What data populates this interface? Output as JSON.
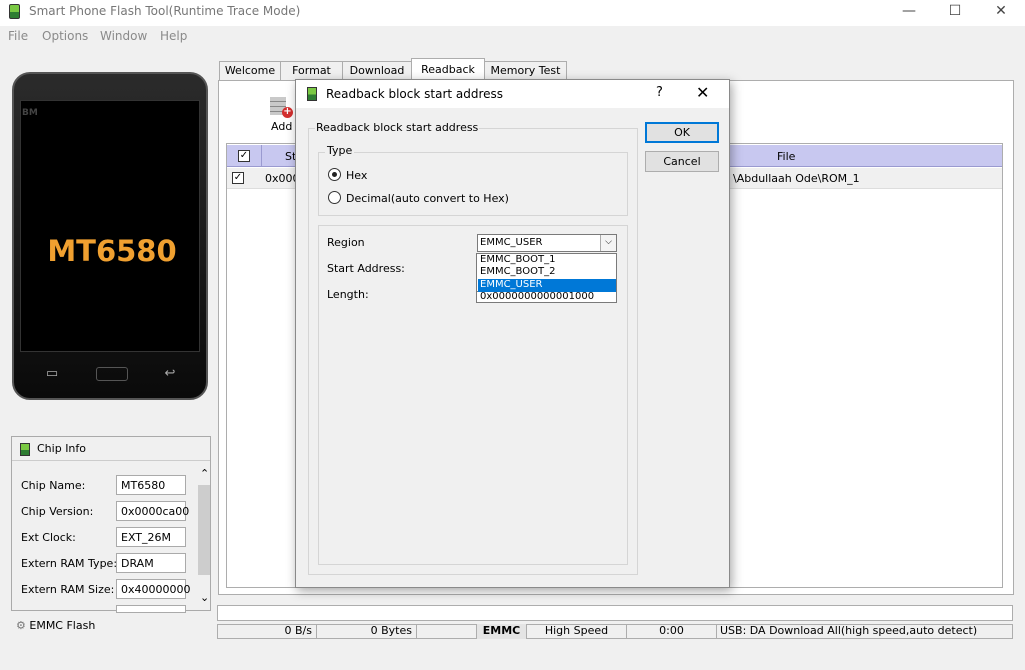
{
  "window": {
    "title": "Smart Phone Flash Tool(Runtime Trace Mode)",
    "minimize": "—",
    "maximize": "☐",
    "close": "✕"
  },
  "menu": [
    "File",
    "Options",
    "Window",
    "Help"
  ],
  "phone": {
    "brand": "BM",
    "chip_label": "MT6580",
    "buttons": [
      "▭",
      "▬",
      "↩"
    ]
  },
  "chip_info": {
    "title": "Chip Info",
    "rows": [
      {
        "label": "Chip Name:",
        "value": "MT6580"
      },
      {
        "label": "Chip Version:",
        "value": "0x0000ca00"
      },
      {
        "label": "Ext Clock:",
        "value": "EXT_26M"
      },
      {
        "label": "Extern RAM Type:",
        "value": "DRAM"
      },
      {
        "label": "Extern RAM Size:",
        "value": "0x40000000"
      }
    ],
    "footer": "EMMC Flash"
  },
  "tabs": [
    "Welcome",
    "Format",
    "Download",
    "Readback",
    "Memory Test"
  ],
  "active_tab": "Readback",
  "toolbar": {
    "add_label": "Add"
  },
  "list": {
    "col_start": "St",
    "col_file": "File",
    "row_start": "0x000",
    "row_file": "\\Abdullaah Ode\\ROM_1"
  },
  "status": {
    "speed": "0 B/s",
    "bytes": "0 Bytes",
    "storage": "EMMC",
    "usb_mode": "High Speed",
    "time": "0:00",
    "message": "USB: DA Download All(high speed,auto detect)"
  },
  "dialog": {
    "title": "Readback block start address",
    "help": "?",
    "close": "✕",
    "group_label": "Readback block start address",
    "type_label": "Type",
    "radio_hex": "Hex",
    "radio_decimal": "Decimal(auto convert to Hex)",
    "region_label": "Region",
    "start_label": "Start Address:",
    "length_label": "Length:",
    "region_value": "EMMC_USER",
    "region_options": [
      "EMMC_BOOT_1",
      "EMMC_BOOT_2",
      "EMMC_USER"
    ],
    "length_value": "0x0000000000001000",
    "ok": "OK",
    "cancel": "Cancel"
  },
  "colors": {
    "list_header": "#c8c8f0",
    "selection": "#0078d7",
    "chip_text": "#f0a030"
  }
}
